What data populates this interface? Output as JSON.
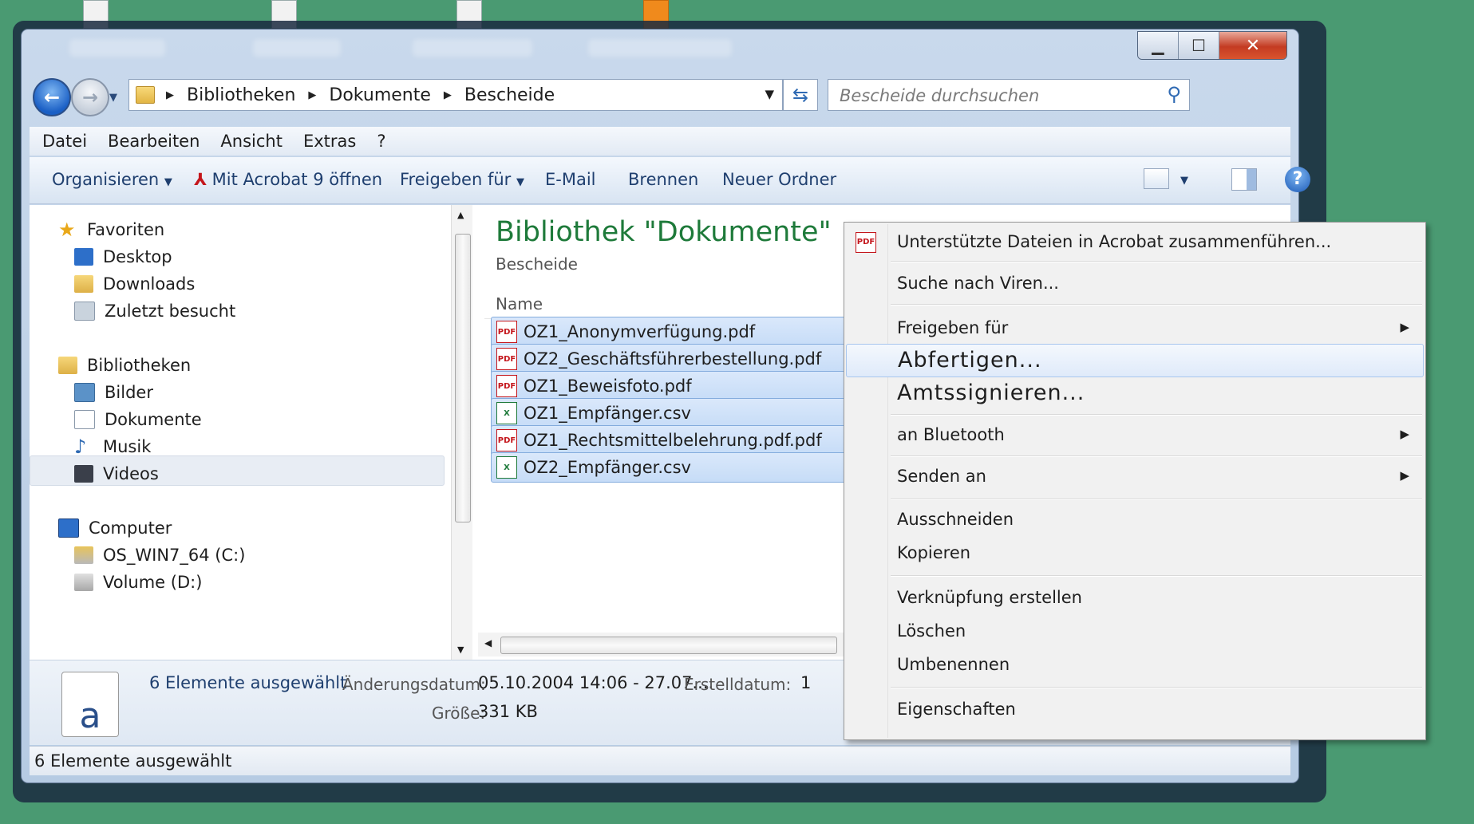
{
  "window": {
    "min_glyph": "▁",
    "max_glyph": "☐",
    "close_glyph": "✕"
  },
  "nav": {
    "back_glyph": "←",
    "forward_glyph": "→",
    "breadcrumb": [
      "Bibliotheken",
      "Dokumente",
      "Bescheide"
    ],
    "search_placeholder": "Bescheide durchsuchen"
  },
  "menubar": [
    "Datei",
    "Bearbeiten",
    "Ansicht",
    "Extras",
    "?"
  ],
  "toolbar": {
    "organize": "Organisieren",
    "acrobat": "Mit Acrobat 9 öffnen",
    "share": "Freigeben für",
    "email": "E-Mail",
    "burn": "Brennen",
    "new_folder": "Neuer Ordner"
  },
  "navpane": {
    "favorites": "Favoriten",
    "desktop": "Desktop",
    "downloads": "Downloads",
    "recent": "Zuletzt besucht",
    "libraries": "Bibliotheken",
    "pictures": "Bilder",
    "documents": "Dokumente",
    "music": "Musik",
    "videos": "Videos",
    "computer": "Computer",
    "drive_c": "OS_WIN7_64 (C:)",
    "drive_d": "Volume (D:)"
  },
  "library": {
    "title": "Bibliothek \"Dokumente\"",
    "subtitle": "Bescheide",
    "column_name": "Name"
  },
  "files": [
    {
      "name": "OZ1_Anonymverfügung.pdf",
      "type": "pdf"
    },
    {
      "name": "OZ2_Geschäftsführerbestellung.pdf",
      "type": "pdf"
    },
    {
      "name": "OZ1_Beweisfoto.pdf",
      "type": "pdf"
    },
    {
      "name": "OZ1_Empfänger.csv",
      "type": "csv"
    },
    {
      "name": "OZ1_Rechtsmittelbelehrung.pdf.pdf",
      "type": "pdf"
    },
    {
      "name": "OZ2_Empfänger.csv",
      "type": "csv"
    }
  ],
  "details": {
    "selected": "6 Elemente ausgewählt",
    "modified_label": "Änderungsdatum:",
    "modified_value": "05.10.2004 14:06 - 27.07....",
    "created_label": "Erstelldatum:",
    "created_value": "1",
    "size_label": "Größe:",
    "size_value": "331 KB"
  },
  "status": "6 Elemente ausgewählt",
  "context_menu": {
    "merge": "Unterstützte Dateien in Acrobat zusammenführen...",
    "virus": "Suche nach Viren...",
    "share": "Freigeben für",
    "dispatch": "Abfertigen...",
    "sign": "Amtssignieren...",
    "bluetooth": "an Bluetooth",
    "send_to": "Senden an",
    "cut": "Ausschneiden",
    "copy": "Kopieren",
    "shortcut": "Verknüpfung erstellen",
    "delete": "Löschen",
    "rename": "Umbenennen",
    "properties": "Eigenschaften"
  }
}
